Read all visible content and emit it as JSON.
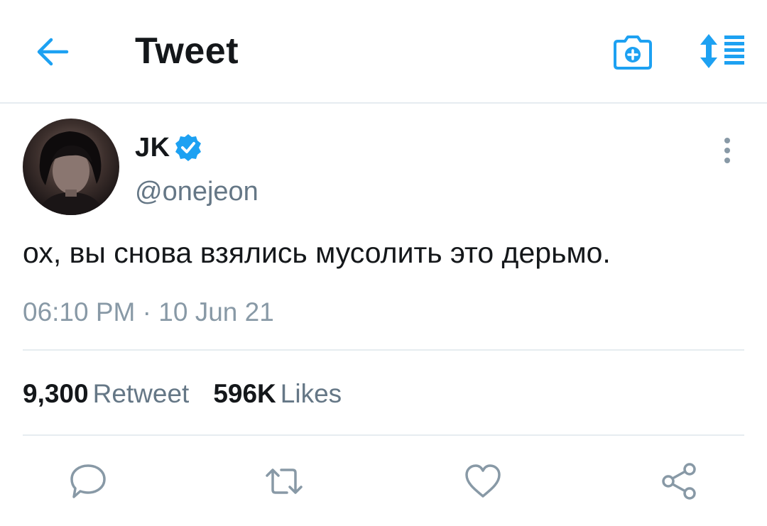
{
  "header": {
    "title": "Tweet",
    "icons": [
      "back-arrow-icon",
      "camera-add-icon",
      "sort-icon"
    ],
    "accent_color": "#1da1f2"
  },
  "tweet": {
    "author_name": "JK",
    "author_handle": "@onejeon",
    "verified": true,
    "text": "ох, вы снова взялись мусолить это дерьмо.",
    "time": "06:10 PM",
    "separator": "·",
    "date": "10 Jun 21"
  },
  "stats": {
    "retweet_count": "9,300",
    "retweet_label": "Retweet",
    "likes_count": "596K",
    "likes_label": "Likes"
  },
  "actions": [
    "reply-icon",
    "retweet-icon",
    "like-icon",
    "share-icon"
  ],
  "colors": {
    "text_primary": "#14171a",
    "text_secondary": "#657786",
    "icon_gray": "#8899a6",
    "divider": "#e6ecf0"
  }
}
